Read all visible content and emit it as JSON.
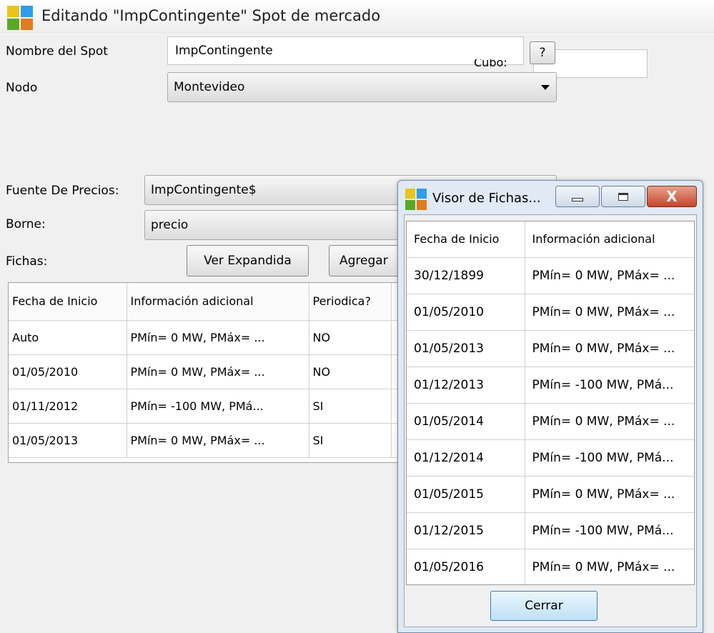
{
  "window": {
    "title": "Editando \"ImpContingente\" Spot de mercado"
  },
  "form": {
    "nombre_label": "Nombre del Spot",
    "nombre_value": "ImpContingente",
    "help_label": "?",
    "cubo_label": "Cubo:",
    "cubo_value": "",
    "nodo_label": "Nodo",
    "nodo_value": "Montevideo",
    "fuente_label": "Fuente De Precios:",
    "fuente_value": "ImpContingente$",
    "borne_label": "Borne:",
    "borne_value": "precio",
    "fichas_label": "Fichas:",
    "ver_expandida_label": "Ver Expandida",
    "agregar_label": "Agregar"
  },
  "fichas_table": {
    "columns": [
      "Fecha de Inicio",
      "Información adicional",
      "Periodica?"
    ],
    "rows": [
      [
        "Auto",
        "PMín= 0 MW, PMáx= ...",
        "NO"
      ],
      [
        "01/05/2010",
        "PMín= 0 MW, PMáx= ...",
        "NO"
      ],
      [
        "01/11/2012",
        "PMín= -100 MW, PMá...",
        "SI"
      ],
      [
        "01/05/2013",
        "PMín= 0 MW, PMáx= ...",
        "SI"
      ]
    ]
  },
  "dialog": {
    "title": "Visor de Fichas...",
    "close_glyph": "X",
    "columns": [
      "Fecha de Inicio",
      "Información adicional"
    ],
    "rows": [
      [
        "30/12/1899",
        "PMín= 0 MW, PMáx= ..."
      ],
      [
        "01/05/2010",
        "PMín= 0 MW, PMáx= ..."
      ],
      [
        "01/05/2013",
        "PMín= 0 MW, PMáx= ..."
      ],
      [
        "01/12/2013",
        "PMín= -100 MW, PMá..."
      ],
      [
        "01/05/2014",
        "PMín= 0 MW, PMáx= ..."
      ],
      [
        "01/12/2014",
        "PMín= -100 MW, PMá..."
      ],
      [
        "01/05/2015",
        "PMín= 0 MW, PMáx= ..."
      ],
      [
        "01/12/2015",
        "PMín= -100 MW, PMá..."
      ],
      [
        "01/05/2016",
        "PMín= 0 MW, PMáx= ..."
      ]
    ],
    "cerrar_label": "Cerrar"
  },
  "icons": {
    "app": "app-logo-icon",
    "dropdown": "chevron-down-icon"
  }
}
